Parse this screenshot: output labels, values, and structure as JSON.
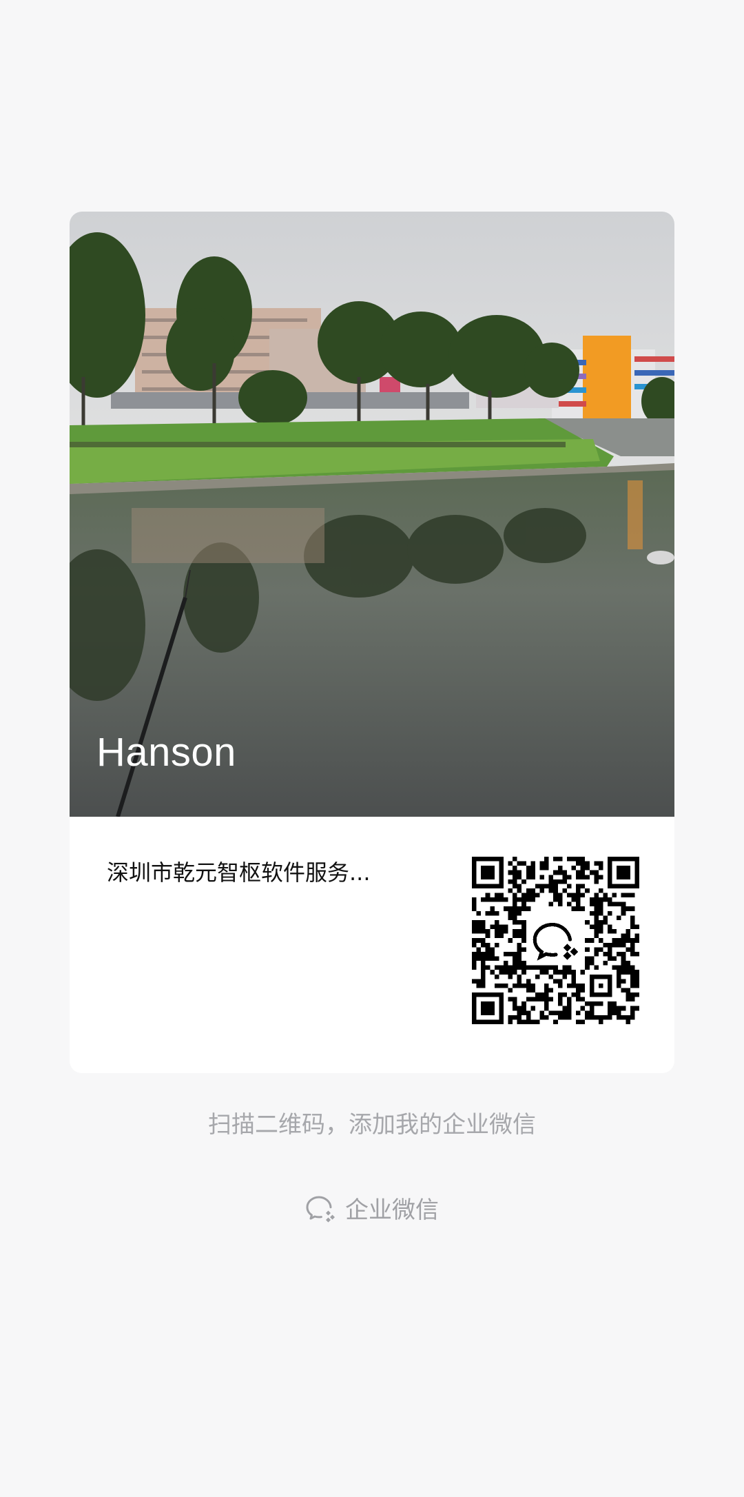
{
  "card": {
    "name": "Hanson",
    "company": "深圳市乾元智枢软件服务..."
  },
  "qr": {
    "center_icon": "wecom-logo-icon"
  },
  "hint": "扫描二维码，添加我的企业微信",
  "brand": {
    "icon": "wecom-logo-icon",
    "label": "企业微信"
  },
  "colors": {
    "background": "#f7f7f8",
    "card": "#ffffff",
    "muted_text": "#a6a7ab"
  }
}
